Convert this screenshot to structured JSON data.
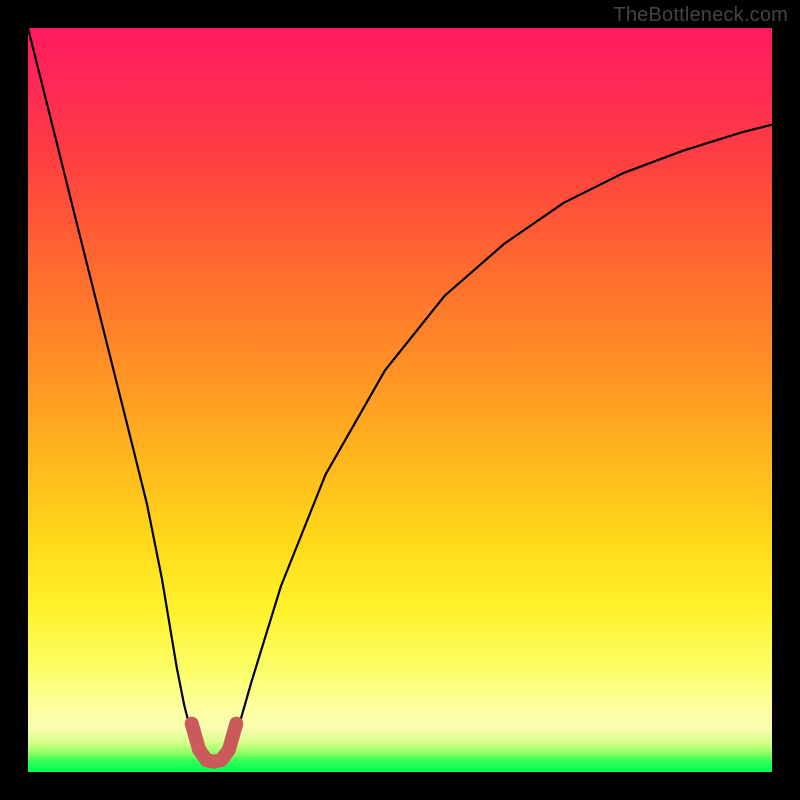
{
  "watermark": "TheBottleneck.com",
  "chart_data": {
    "type": "line",
    "title": "",
    "xlabel": "",
    "ylabel": "",
    "xlim": [
      0,
      100
    ],
    "ylim": [
      0,
      100
    ],
    "grid": false,
    "legend": false,
    "series": [
      {
        "name": "bottleneck-curve",
        "color": "#000000",
        "x": [
          0,
          2,
          4,
          6,
          8,
          10,
          12,
          14,
          16,
          18,
          20,
          21,
          22,
          23,
          24,
          25,
          26,
          27,
          28,
          30,
          34,
          40,
          48,
          56,
          64,
          72,
          80,
          88,
          96,
          100
        ],
        "y": [
          100,
          92,
          84,
          76,
          68,
          60,
          52,
          44,
          36,
          26,
          14,
          9,
          5,
          2.5,
          1.6,
          1.4,
          1.6,
          2.5,
          5,
          12,
          25,
          40,
          54,
          64,
          71,
          76.5,
          80.5,
          83.5,
          86,
          87
        ]
      },
      {
        "name": "optimum-marker",
        "color": "#cc5a5a",
        "x": [
          22,
          23,
          24,
          25,
          25.5,
          26,
          27,
          28
        ],
        "y": [
          6.5,
          3.0,
          1.6,
          1.4,
          1.5,
          1.6,
          3.0,
          6.5
        ]
      }
    ],
    "background_gradient_stops": [
      {
        "pos": 0,
        "color": "#ff1a61"
      },
      {
        "pos": 0.45,
        "color": "#ff8f26"
      },
      {
        "pos": 0.78,
        "color": "#fff22a"
      },
      {
        "pos": 0.94,
        "color": "#faffb0"
      },
      {
        "pos": 1.0,
        "color": "#00ff55"
      }
    ]
  }
}
